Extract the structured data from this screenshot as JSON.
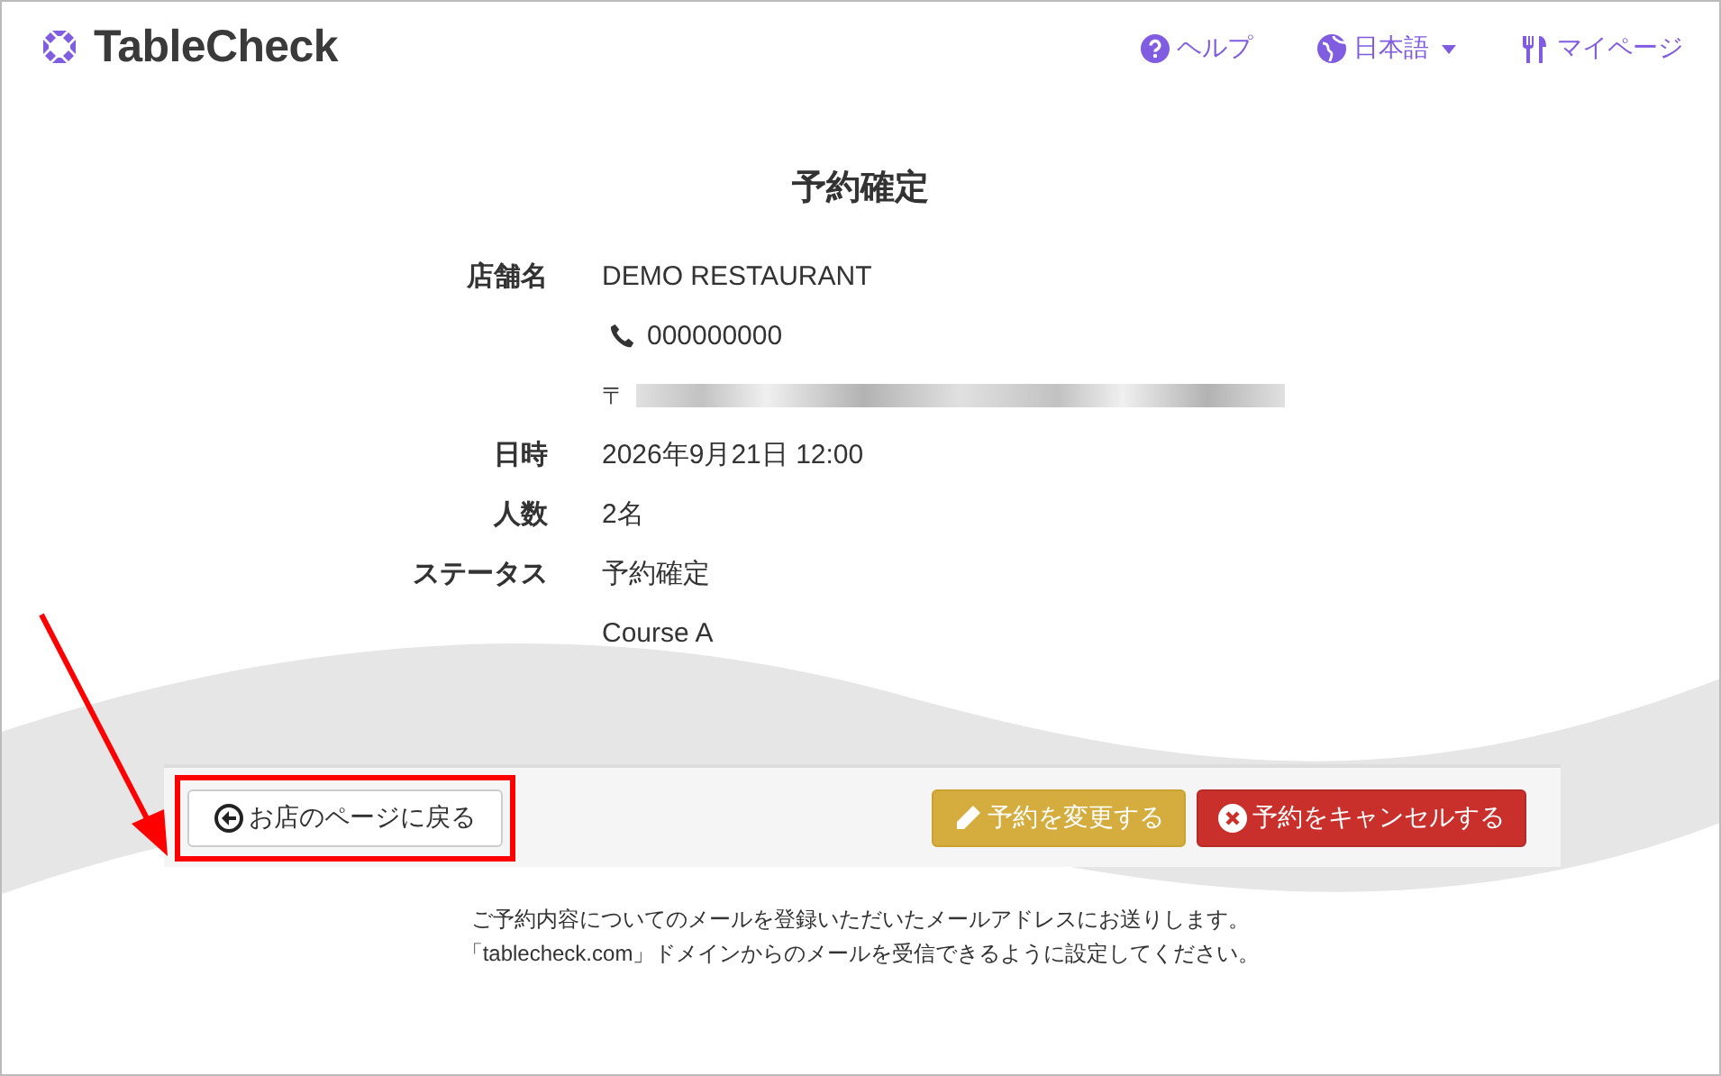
{
  "header": {
    "logo": "TableCheck",
    "nav": [
      {
        "kind": "help",
        "label": "ヘルプ"
      },
      {
        "kind": "language",
        "label": "日本語"
      },
      {
        "kind": "mypage",
        "label": "マイページ"
      }
    ]
  },
  "title": "予約確定",
  "details": [
    {
      "kind": "text",
      "label": "店舗名",
      "value": "DEMO RESTAURANT"
    },
    {
      "kind": "phone",
      "value": "000000000"
    },
    {
      "kind": "address",
      "value": "〒",
      "redacted": true
    },
    {
      "kind": "text",
      "label": "日時",
      "value": "2026年9月21日 12:00"
    },
    {
      "kind": "text",
      "label": "人数",
      "value": "2名"
    },
    {
      "kind": "text",
      "label": "ステータス",
      "value": "予約確定"
    },
    {
      "kind": "text",
      "value": "Course A"
    }
  ],
  "actions": [
    {
      "kind": "back",
      "label": "お店のページに戻る",
      "highlighted": true
    },
    {
      "kind": "edit",
      "label": "予約を変更する",
      "highlighted": false
    },
    {
      "kind": "cancel",
      "label": "予約をキャンセルする",
      "highlighted": false
    }
  ],
  "notes": [
    "ご予約内容についてのメールを登録いただいたメールアドレスにお送りします。",
    "「tablecheck.com」ドメインからのメールを受信できるように設定してください。"
  ]
}
